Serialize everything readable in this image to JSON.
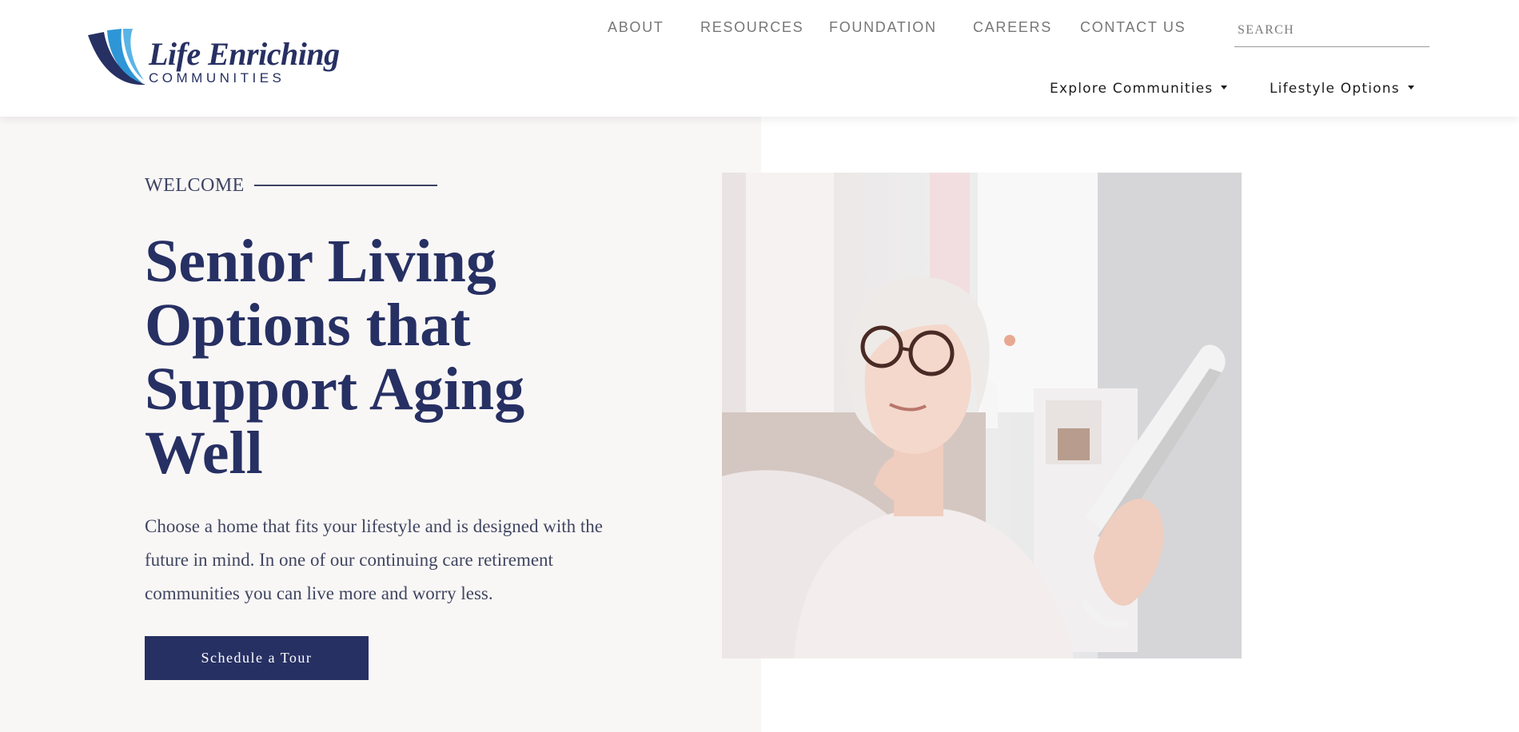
{
  "brand": {
    "name": "Life Enriching",
    "subtitle": "COMMUNITIES",
    "colors": {
      "navy": "#273063",
      "blue": "#2e96d6"
    }
  },
  "top_nav": {
    "items": [
      {
        "label": "ABOUT"
      },
      {
        "label": "RESOURCES"
      },
      {
        "label": "FOUNDATION"
      },
      {
        "label": "CAREERS"
      },
      {
        "label": "CONTACT US"
      }
    ]
  },
  "search": {
    "placeholder": "SEARCH",
    "value": ""
  },
  "sub_nav": {
    "items": [
      {
        "label": "Explore Communities",
        "icon": "caret-down-icon"
      },
      {
        "label": "Lifestyle Options",
        "icon": "caret-down-icon"
      }
    ]
  },
  "hero": {
    "eyebrow": "WELCOME",
    "title": "Senior Living Options that Support Aging Well",
    "intro": "Choose a home that fits your lifestyle and is designed with the future in mind. In one of our continuing care retirement communities you can live more and worry less.",
    "cta_label": "Schedule a Tour",
    "image": "photo-senior-woman-reading-tablet"
  }
}
